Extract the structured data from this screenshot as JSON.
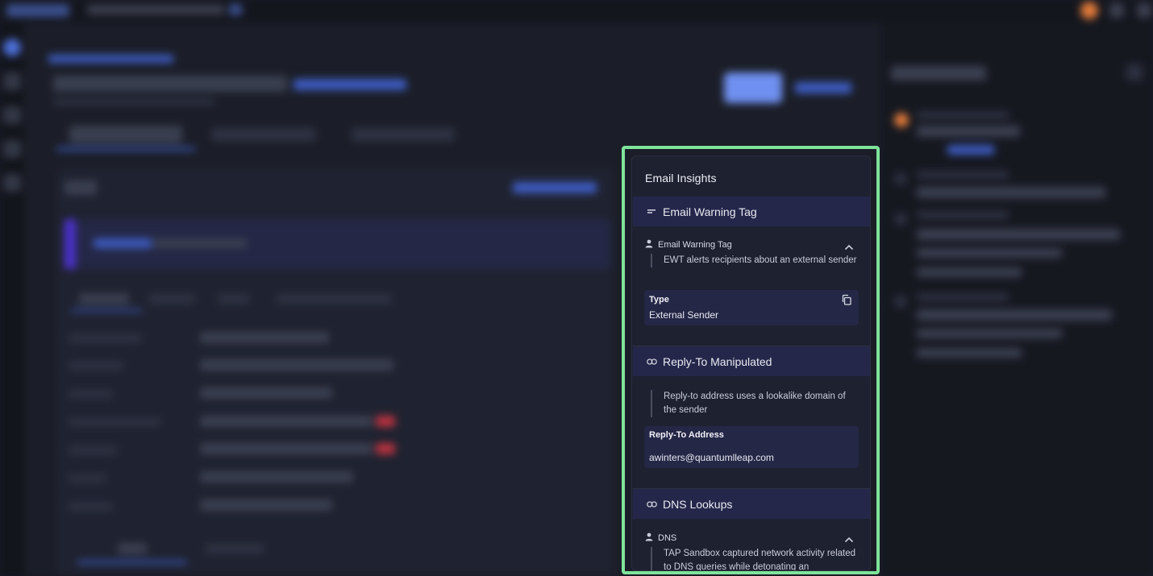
{
  "card": {
    "title": "Email Insights"
  },
  "sections": {
    "warning": {
      "header": "Email Warning Tag",
      "header_icon": "tag-lines-icon",
      "item_label": "Email Warning Tag",
      "description": "EWT alerts recipients about an external sender",
      "field_label": "Type",
      "field_value": "External Sender"
    },
    "replyto": {
      "header": "Reply-To Manipulated",
      "header_icon": "link-icon",
      "description": "Reply-to address uses a lookalike domain of the sender",
      "field_label": "Reply-To Address",
      "field_value": "awinters@quantumlleap.com"
    },
    "dns": {
      "header": "DNS Lookups",
      "header_icon": "link-icon",
      "item_label": "DNS",
      "description": "TAP Sandbox captured network activity related to DNS queries while detonating an"
    }
  },
  "colors": {
    "highlight_border": "#7fe39a",
    "section_header_bg": "#25274a",
    "card_bg": "#1e2130"
  }
}
